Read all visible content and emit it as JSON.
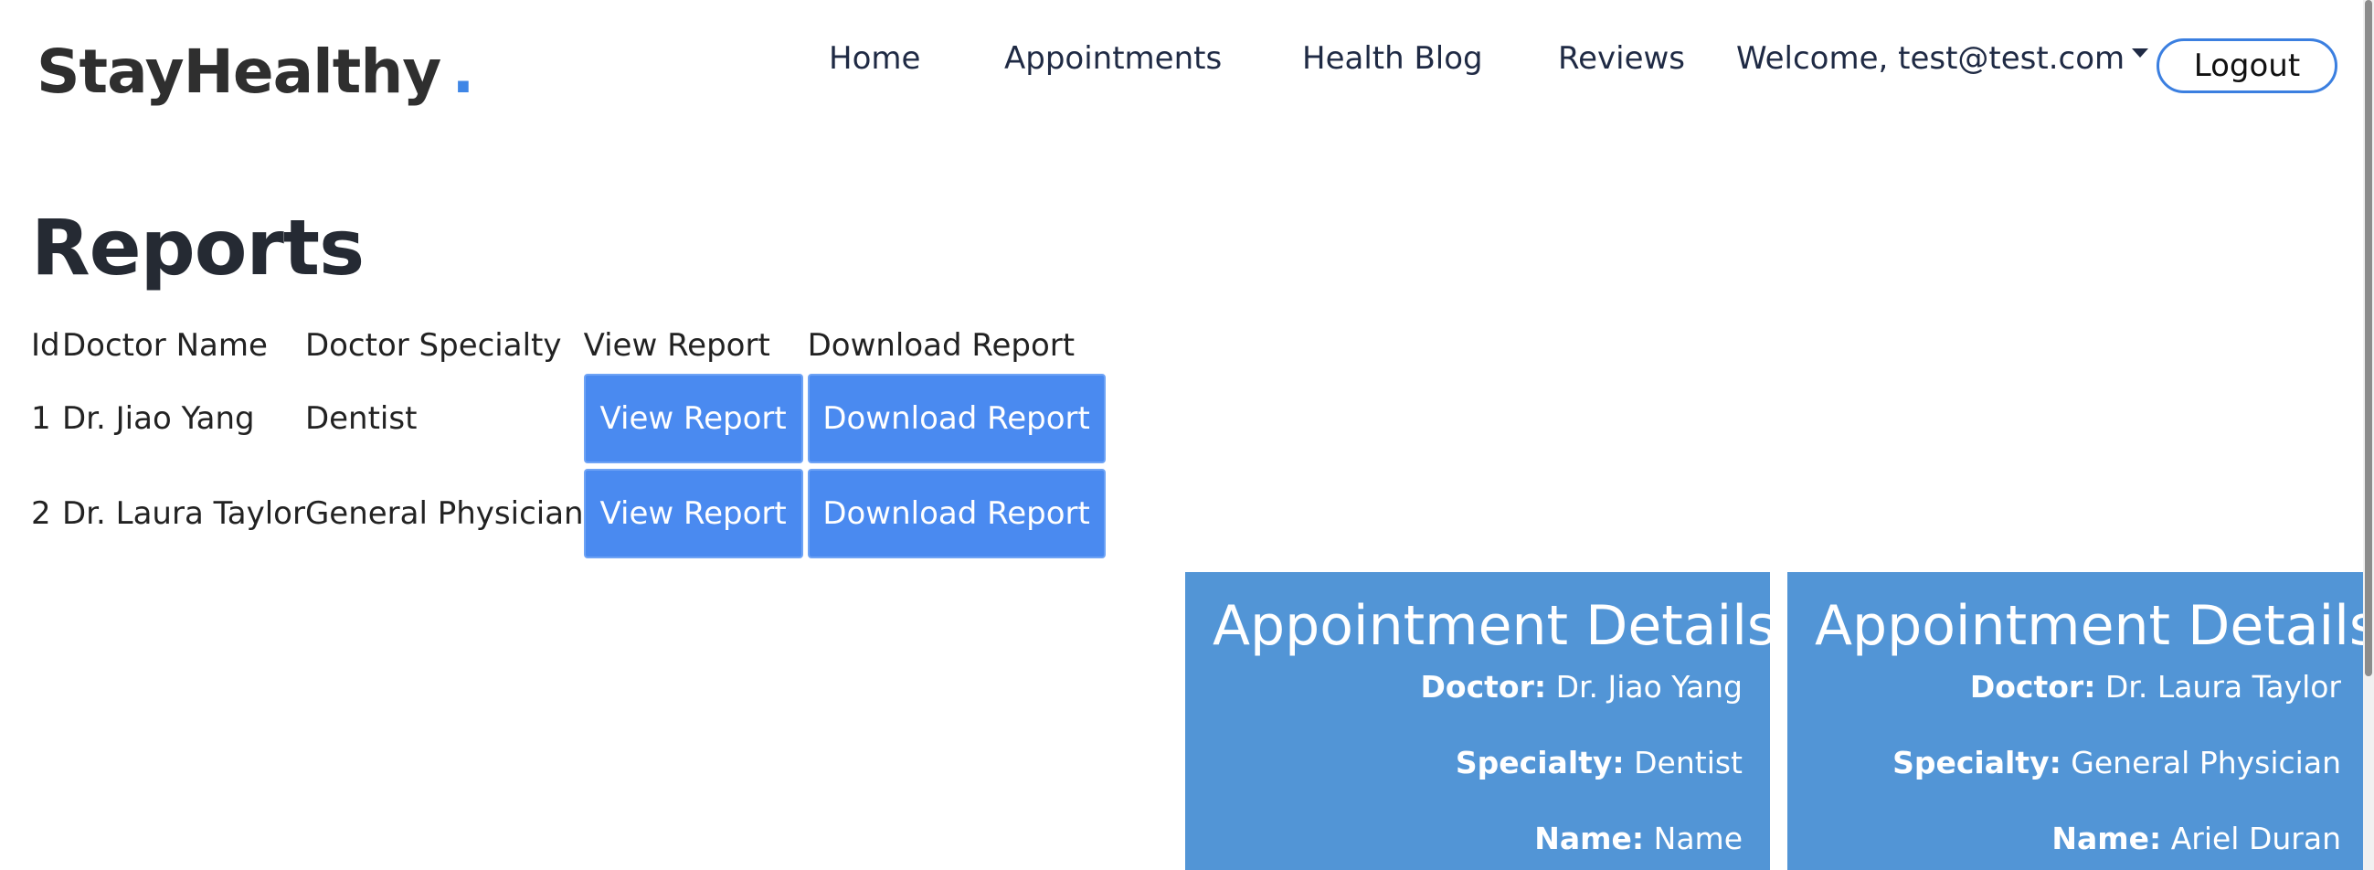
{
  "nav": {
    "brand": "StayHealthy",
    "brand_dot": ".",
    "links": [
      "Home",
      "Appointments",
      "Health Blog",
      "Reviews"
    ],
    "welcome": "Welcome, test@test.com",
    "logout": "Logout"
  },
  "reports": {
    "title": "Reports",
    "headers": [
      "Id",
      "Doctor Name",
      "Doctor Specialty",
      "View Report",
      "Download Report"
    ],
    "rows": [
      {
        "id": "1",
        "doctor": "Dr. Jiao Yang",
        "specialty": "Dentist",
        "view_label": "View Report",
        "download_label": "Download Report"
      },
      {
        "id": "2",
        "doctor": "Dr. Laura Taylor",
        "specialty": "General Physician",
        "view_label": "View Report",
        "download_label": "Download Report"
      }
    ]
  },
  "appointments": [
    {
      "title": "Appointment Details",
      "doctor_label": "Doctor:",
      "doctor": "Dr. Jiao Yang",
      "specialty_label": "Specialty:",
      "specialty": "Dentist",
      "name_label": "Name:",
      "name": "Name"
    },
    {
      "title": "Appointment Details",
      "doctor_label": "Doctor:",
      "doctor": "Dr. Laura Taylor",
      "specialty_label": "Specialty:",
      "specialty": "General Physician",
      "name_label": "Name:",
      "name": "Ariel Duran"
    }
  ],
  "colors": {
    "accent": "#3f86e6",
    "button": "#4a8af0",
    "card": "#5295d6",
    "text": "#212529"
  }
}
